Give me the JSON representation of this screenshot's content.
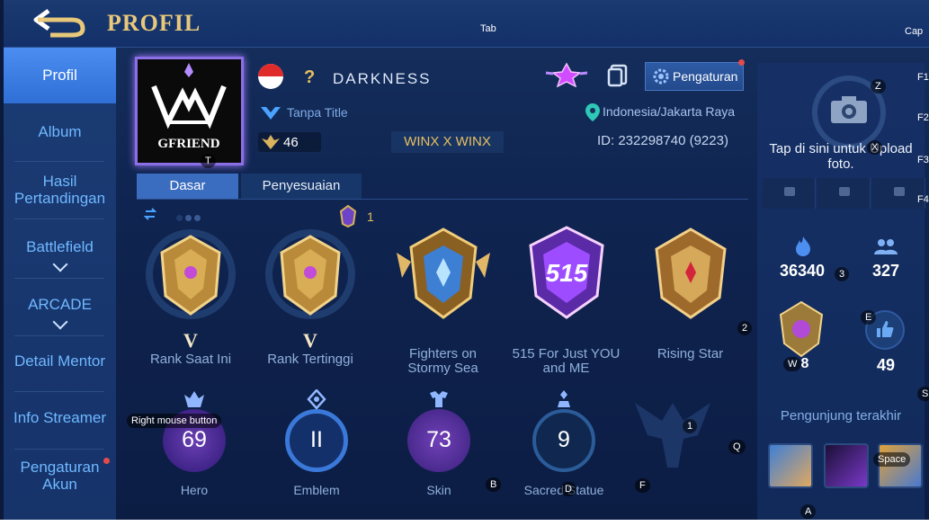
{
  "header": {
    "title": "PROFIL"
  },
  "overlay_keys": {
    "tab": "Tab",
    "cap": "Cap",
    "f1": "F1",
    "f2": "F2",
    "f3": "F3",
    "f4": "F4",
    "z": "Z",
    "x": "X",
    "t": "T",
    "k3": "3",
    "k2": "2",
    "e": "E",
    "w": "W",
    "s": "S",
    "k1": "1",
    "q": "Q",
    "b": "B",
    "d": "D",
    "f": "F",
    "a": "A",
    "space": "Space",
    "rmb": "Right mouse button"
  },
  "sidebar": {
    "items": [
      {
        "label": "Profil"
      },
      {
        "label": "Album"
      },
      {
        "label": "Hasil Pertandingan"
      },
      {
        "label": "Battlefield"
      },
      {
        "label": "ARCADE"
      },
      {
        "label": "Detail Mentor"
      },
      {
        "label": "Info Streamer"
      },
      {
        "label": "Pengaturan Akun"
      }
    ]
  },
  "profile": {
    "avatar_text": "GFRIEND",
    "question": "?",
    "nickname": "DARKNESS",
    "title": "Tanpa Title",
    "level": "46",
    "squad": "WINX X WINX",
    "location": "Indonesia/Jakarta Raya",
    "id": "ID: 232298740 (9223)",
    "settings_label": "Pengaturan"
  },
  "tabs": [
    {
      "label": "Dasar"
    },
    {
      "label": "Penyesuaian"
    }
  ],
  "badge_count": "1",
  "medals": [
    {
      "rank": "V",
      "caption": "Rank Saat Ini"
    },
    {
      "rank": "V",
      "caption": "Rank Tertinggi"
    },
    {
      "caption": "Fighters on Stormy Sea"
    },
    {
      "caption": "515 For Just YOU and ME",
      "emblem_text": "515"
    },
    {
      "caption": "Rising Star"
    }
  ],
  "stats": [
    {
      "value": "69",
      "caption": "Hero"
    },
    {
      "value": "II",
      "caption": "Emblem"
    },
    {
      "value": "73",
      "caption": "Skin"
    },
    {
      "value": "9",
      "caption": "Sacred Statue"
    }
  ],
  "right_panel": {
    "upload_text": "Tap di sini untuk Upload foto.",
    "popularity": "36340",
    "followers": "327",
    "likes": "49",
    "rank_badge_value": "8",
    "visitors_label": "Pengunjung terakhir"
  },
  "colors": {
    "accent_gold": "#e8c87a",
    "accent_blue": "#6fb8ff",
    "active_tab": "#3a6cbf",
    "notification": "#e34b4b"
  }
}
